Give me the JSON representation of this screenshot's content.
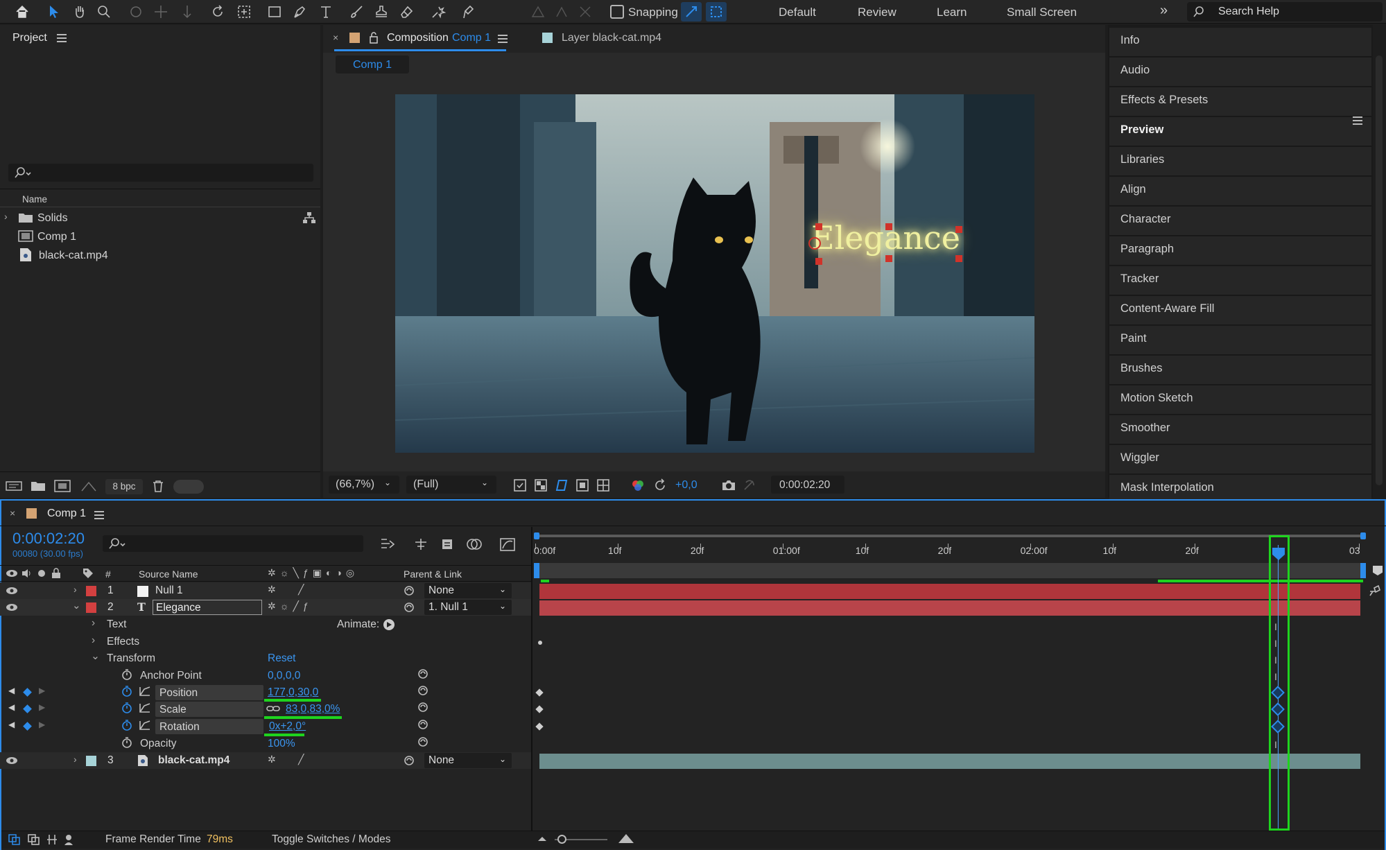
{
  "toolbar": {
    "snapping_label": "Snapping",
    "workspaces": [
      "Default",
      "Review",
      "Learn",
      "Small Screen"
    ],
    "search_placeholder": "Search Help"
  },
  "project": {
    "title": "Project",
    "column_name": "Name",
    "items": [
      {
        "icon": "folder-icon",
        "label": "Solids"
      },
      {
        "icon": "composition-icon",
        "label": "Comp 1"
      },
      {
        "icon": "footage-icon",
        "label": "black-cat.mp4"
      }
    ],
    "bpc": "8 bpc"
  },
  "comp_panel": {
    "tab_prefix": "Composition",
    "tab_comp": "Comp 1",
    "layer_tab": "Layer black-cat.mp4",
    "subtab": "Comp 1",
    "overlay_text": "Elegance",
    "zoom": "(66,7%)",
    "resolution": "(Full)",
    "exposure": "+0,0",
    "timecode": "0:00:02:20"
  },
  "right_panels": [
    "Info",
    "Audio",
    "Effects & Presets",
    "Preview",
    "Libraries",
    "Align",
    "Character",
    "Paragraph",
    "Tracker",
    "Content-Aware Fill",
    "Paint",
    "Brushes",
    "Motion Sketch",
    "Smoother",
    "Wiggler",
    "Mask Interpolation"
  ],
  "timeline": {
    "tab": "Comp 1",
    "current_time": "0:00:02:20",
    "frame_info": "00080 (30.00 fps)",
    "col_num": "#",
    "col_source": "Source Name",
    "col_parent": "Parent & Link",
    "ruler": [
      "0:00f",
      "10f",
      "20f",
      "01:00f",
      "10f",
      "20f",
      "02:00f",
      "10f",
      "20f",
      "03"
    ],
    "layers": [
      {
        "num": "1",
        "name": "Null 1",
        "parent": "None"
      },
      {
        "num": "2",
        "name": "Elegance",
        "parent": "1. Null 1"
      },
      {
        "num": "3",
        "name": "black-cat.mp4",
        "parent": "None"
      }
    ],
    "props": {
      "text": "Text",
      "animate": "Animate:",
      "effects": "Effects",
      "transform": "Transform",
      "reset": "Reset",
      "anchor": "Anchor Point",
      "anchor_val": "0,0,0,0",
      "position": "Position",
      "position_val": "177,0,30,0",
      "scale": "Scale",
      "scale_val": "83,0,83,0%",
      "rotation": "Rotation",
      "rotation_val": "0x+2,0°",
      "opacity": "Opacity",
      "opacity_val": "100%"
    },
    "status": {
      "render_label": "Frame Render Time",
      "render_value": "79ms",
      "toggle": "Toggle Switches / Modes"
    }
  },
  "colors": {
    "accent": "#2d8ceb",
    "layer_red": "#b0353b",
    "layer_teal": "#6c8e8e",
    "highlight": "#1ed41e"
  }
}
